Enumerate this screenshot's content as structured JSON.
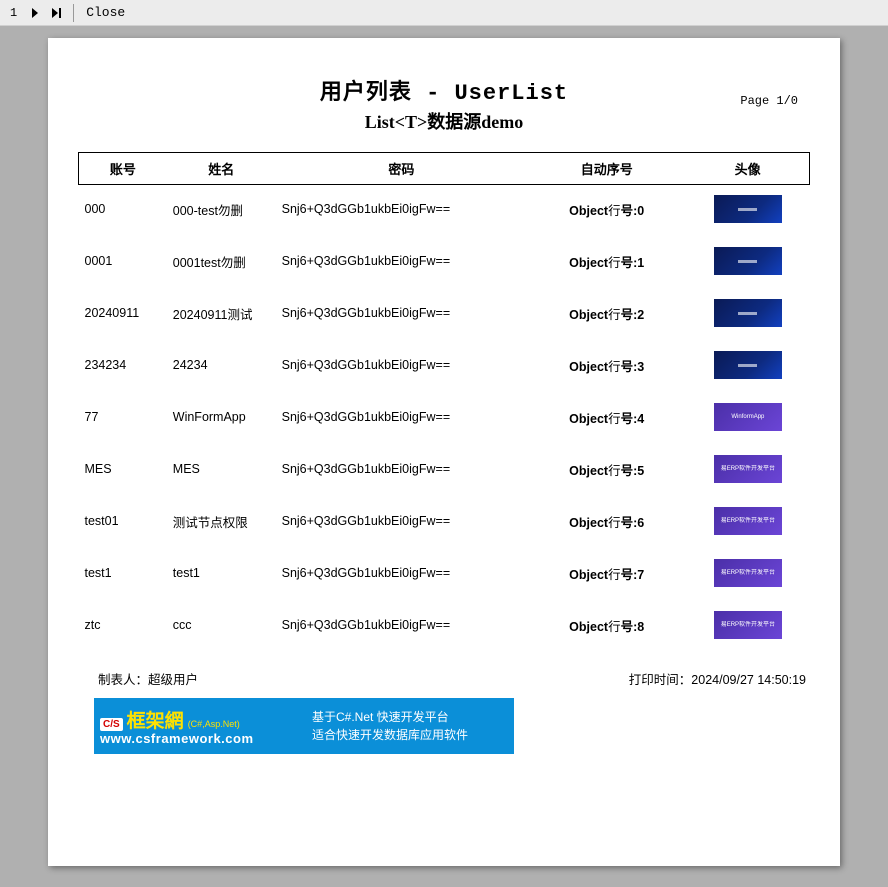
{
  "toolbar": {
    "page_number": "1",
    "close_label": "Close"
  },
  "title": {
    "main": "用户列表 - UserList",
    "sub": "List<T>数据源demo",
    "page_label": "Page 1/0"
  },
  "table": {
    "headers": {
      "account": "账号",
      "name": "姓名",
      "password": "密码",
      "seq": "自动序号",
      "avatar": "头像"
    },
    "seq_prefix_bold": "Object",
    "seq_mid": "行",
    "seq_label": "号",
    "rows": [
      {
        "account": "000",
        "name": "000-test勿删",
        "password": "Snj6+Q3dGGb1ukbEi0igFw==",
        "seq_n": "0",
        "avatar_style": "a",
        "avatar_label": ""
      },
      {
        "account": "0001",
        "name": "0001test勿删",
        "password": "Snj6+Q3dGGb1ukbEi0igFw==",
        "seq_n": "1",
        "avatar_style": "a",
        "avatar_label": ""
      },
      {
        "account": "20240911",
        "name": "20240911测试",
        "password": "Snj6+Q3dGGb1ukbEi0igFw==",
        "seq_n": "2",
        "avatar_style": "a",
        "avatar_label": ""
      },
      {
        "account": "234234",
        "name": "24234",
        "password": "Snj6+Q3dGGb1ukbEi0igFw==",
        "seq_n": "3",
        "avatar_style": "a",
        "avatar_label": ""
      },
      {
        "account": "77",
        "name": "WinFormApp",
        "password": "Snj6+Q3dGGb1ukbEi0igFw==",
        "seq_n": "4",
        "avatar_style": "b",
        "avatar_label": "WinformApp"
      },
      {
        "account": "MES",
        "name": "MES",
        "password": "Snj6+Q3dGGb1ukbEi0igFw==",
        "seq_n": "5",
        "avatar_style": "b",
        "avatar_label": "易ERP软件开发平台"
      },
      {
        "account": "test01",
        "name": "测试节点权限",
        "password": "Snj6+Q3dGGb1ukbEi0igFw==",
        "seq_n": "6",
        "avatar_style": "b",
        "avatar_label": "易ERP软件开发平台"
      },
      {
        "account": "test1",
        "name": "test1",
        "password": "Snj6+Q3dGGb1ukbEi0igFw==",
        "seq_n": "7",
        "avatar_style": "b",
        "avatar_label": "易ERP软件开发平台"
      },
      {
        "account": "ztc",
        "name": "ccc",
        "password": "Snj6+Q3dGGb1ukbEi0igFw==",
        "seq_n": "8",
        "avatar_style": "b",
        "avatar_label": "易ERP软件开发平台"
      }
    ]
  },
  "footer": {
    "maker_label": "制表人：",
    "maker_value": "超级用户",
    "print_label": "打印时间：",
    "print_value": "2024/09/27 14:50:19"
  },
  "banner": {
    "badge": "C/S",
    "big_text": "框架網",
    "small_text": "(C#,Asp.Net)",
    "url": "www.csframework.com",
    "line1": "基于C#.Net 快速开发平台",
    "line2": "适合快速开发数据库应用软件"
  }
}
